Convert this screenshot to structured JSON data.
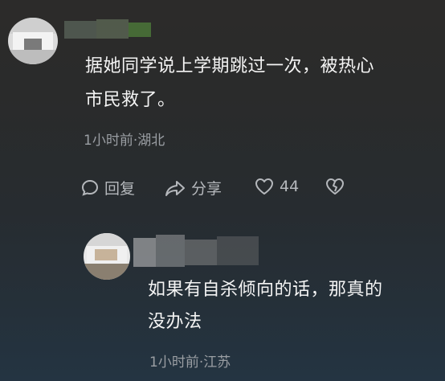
{
  "comment1": {
    "text_line1": "据她同学说上学期跳过一次，被热心",
    "text_line2": "市民救了。",
    "meta": "1小时前·湖北",
    "actions": {
      "reply_label": "回复",
      "share_label": "分享",
      "like_count": "44"
    }
  },
  "reply1": {
    "text_line1": "如果有自杀倾向的话，那真的",
    "text_line2": "没办法",
    "meta": "1小时前·江苏"
  },
  "colors": {
    "text": "#f4f4f4",
    "meta": "#9a9ea3",
    "action": "#b5b8bc"
  },
  "icons": [
    "reply-bubble-icon",
    "share-arrow-icon",
    "heart-icon",
    "broken-heart-icon"
  ]
}
